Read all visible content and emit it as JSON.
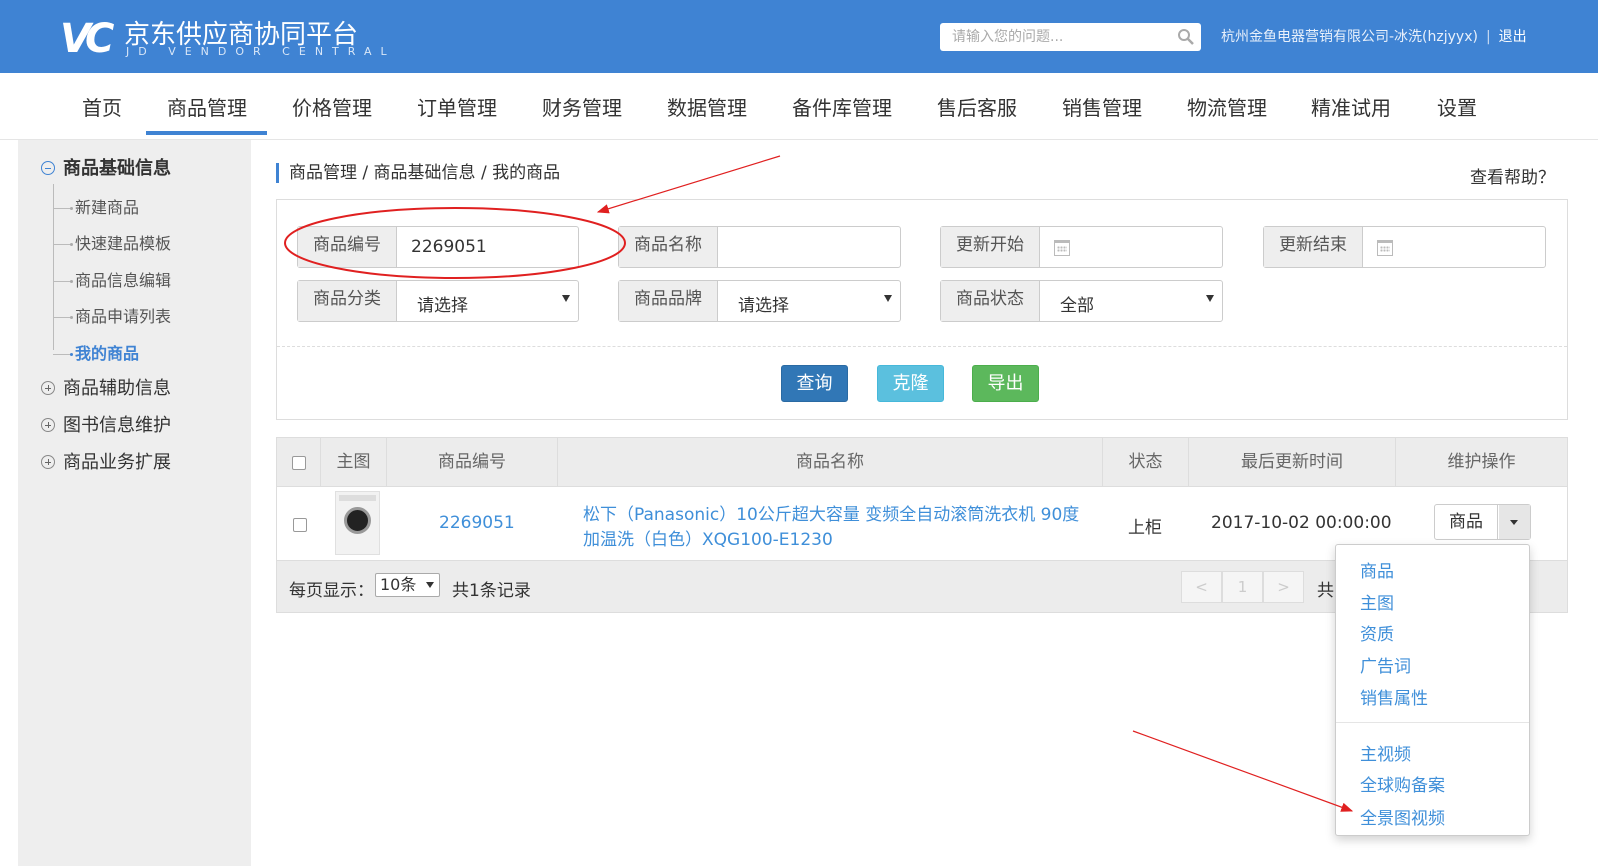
{
  "header": {
    "logo_mark": "VC",
    "logo_cn": "京东供应商协同平台",
    "logo_en": "JD VENDOR CENTRAL",
    "search_placeholder": "请输入您的问题...",
    "user": "杭州金鱼电器营销有限公司-冰洗(hzjyyx)",
    "separator": "|",
    "logout": "退出",
    "bg_color": "#3f83d3"
  },
  "nav": {
    "items": [
      "首页",
      "商品管理",
      "价格管理",
      "订单管理",
      "财务管理",
      "数据管理",
      "备件库管理",
      "售后客服",
      "销售管理",
      "物流管理",
      "精准试用",
      "设置"
    ],
    "active": "商品管理"
  },
  "sidebar": {
    "section_main": "商品基础信息",
    "sub_items": [
      "新建商品",
      "快速建品模板",
      "商品信息编辑",
      "商品申请列表",
      "我的商品"
    ],
    "active_item": "我的商品",
    "sections": [
      "商品辅助信息",
      "图书信息维护",
      "商品业务扩展"
    ]
  },
  "breadcrumb": "商品管理 / 商品基础信息 / 我的商品",
  "help": "查看帮助？",
  "filters": {
    "sku_label": "商品编号",
    "sku_value": "2269051",
    "name_label": "商品名称",
    "name_value": "",
    "update_start_label": "更新开始",
    "update_end_label": "更新结束",
    "category_label": "商品分类",
    "category_value": "请选择",
    "brand_label": "商品品牌",
    "brand_value": "请选择",
    "status_label": "商品状态",
    "status_value": "全部"
  },
  "buttons": {
    "query": "查询",
    "clone": "克隆",
    "export": "导出"
  },
  "table": {
    "headers": [
      "主图",
      "商品编号",
      "商品名称",
      "状态",
      "最后更新时间",
      "维护操作"
    ],
    "rows": [
      {
        "sku": "2269051",
        "name_line1": "松下（Panasonic）10公斤超大容量 变频全自动滚筒洗衣机 90度",
        "name_line2": "加温洗（白色）XQG100-E1230",
        "status": "上柜",
        "updated": "2017-10-02 00:00:00",
        "action": "商品"
      }
    ],
    "footer": {
      "per_page_label": "每页显示：",
      "per_page_value": "10条",
      "total": "共1条记录",
      "prev": "<",
      "page": "1",
      "next": ">",
      "total_pages_prefix": "共"
    }
  },
  "action_menu": {
    "items_group1": [
      "商品",
      "主图",
      "资质",
      "广告词",
      "销售属性"
    ],
    "items_group2": [
      "主视频",
      "全球购备案",
      "全景图视频"
    ]
  }
}
